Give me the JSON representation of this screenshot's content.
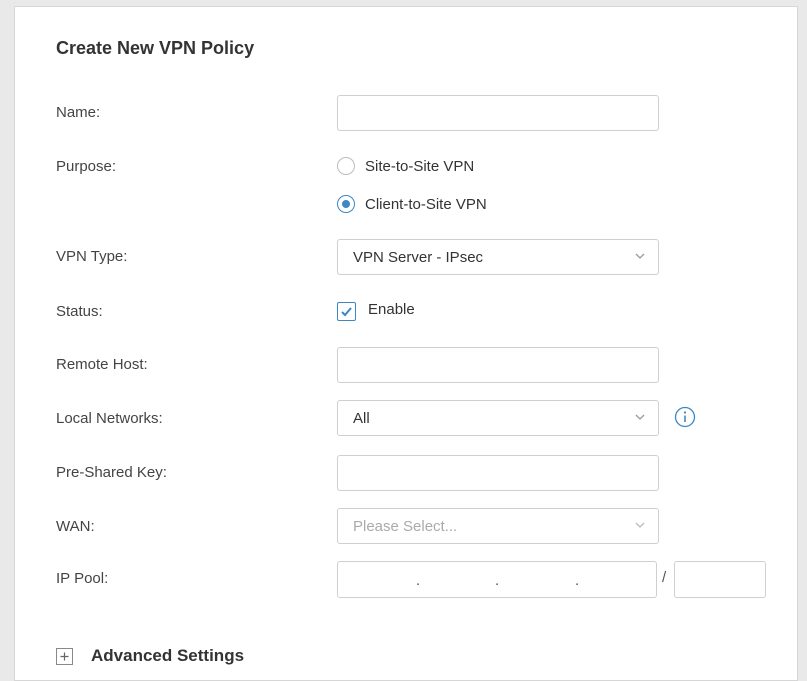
{
  "form": {
    "title": "Create New VPN Policy",
    "name_label": "Name:",
    "name_value": "",
    "purpose_label": "Purpose:",
    "purpose_options": [
      {
        "label": "Site-to-Site VPN",
        "selected": false
      },
      {
        "label": "Client-to-Site VPN",
        "selected": true
      }
    ],
    "vpn_type_label": "VPN Type:",
    "vpn_type_value": "VPN Server - IPsec",
    "status_label": "Status:",
    "status_checkbox_label": "Enable",
    "status_checked": true,
    "remote_host_label": "Remote Host:",
    "remote_host_value": "",
    "local_networks_label": "Local Networks:",
    "local_networks_value": "All",
    "pre_shared_key_label": "Pre-Shared Key:",
    "pre_shared_key_value": "",
    "wan_label": "WAN:",
    "wan_placeholder": "Please Select...",
    "ip_pool_label": "IP Pool:",
    "ip_pool_separator": "/",
    "ip_dot": ".",
    "advanced_label": "Advanced Settings"
  },
  "icons": {
    "dropdown": "chevron-down-icon",
    "info": "info-icon",
    "checkbox": "check-icon",
    "expand": "plus-icon"
  },
  "colors": {
    "accent": "#3d87c5",
    "border": "#cfcfcf",
    "placeholder": "#aaaaaa"
  }
}
